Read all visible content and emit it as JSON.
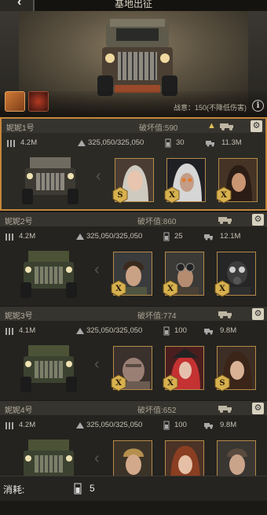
{
  "header": {
    "title": "基地出征",
    "war_meaning": "战意：150(不降低伤害)"
  },
  "teams": [
    {
      "name": "妮妮1号",
      "destroy": "破坏值:590",
      "warning": true,
      "stats": {
        "power": "4.2M",
        "hp": "325,050/325,050",
        "fuel": "30",
        "load": "11.3M"
      },
      "heroes": [
        "female-silver-hair",
        "masked-female",
        "female-dark-hair"
      ]
    },
    {
      "name": "妮妮2号",
      "destroy": "破坏值:860",
      "warning": false,
      "stats": {
        "power": "4.2M",
        "hp": "325,050/325,050",
        "fuel": "25",
        "load": "12.1M"
      },
      "heroes": [
        "male-soldier",
        "male-goggles",
        "gas-mask"
      ]
    },
    {
      "name": "妮妮3号",
      "destroy": "破坏值:774",
      "warning": false,
      "stats": {
        "power": "4.1M",
        "hp": "325,050/325,050",
        "fuel": "100",
        "load": "9.8M"
      },
      "heroes": [
        "brute",
        "female-pirate",
        "female-curly"
      ]
    },
    {
      "name": "妮妮4号",
      "destroy": "破坏值:652",
      "warning": false,
      "stats": {
        "power": "4.2M",
        "hp": "325,050/325,050",
        "fuel": "100",
        "load": "9.8M"
      },
      "heroes": [
        "male-blond",
        "female-auburn",
        "male-stubble"
      ]
    }
  ],
  "footer": {
    "label": "消耗:",
    "value": "5"
  },
  "colors": {
    "accent": "#c4863a",
    "panel": "#24231f",
    "header": "#36342e"
  }
}
